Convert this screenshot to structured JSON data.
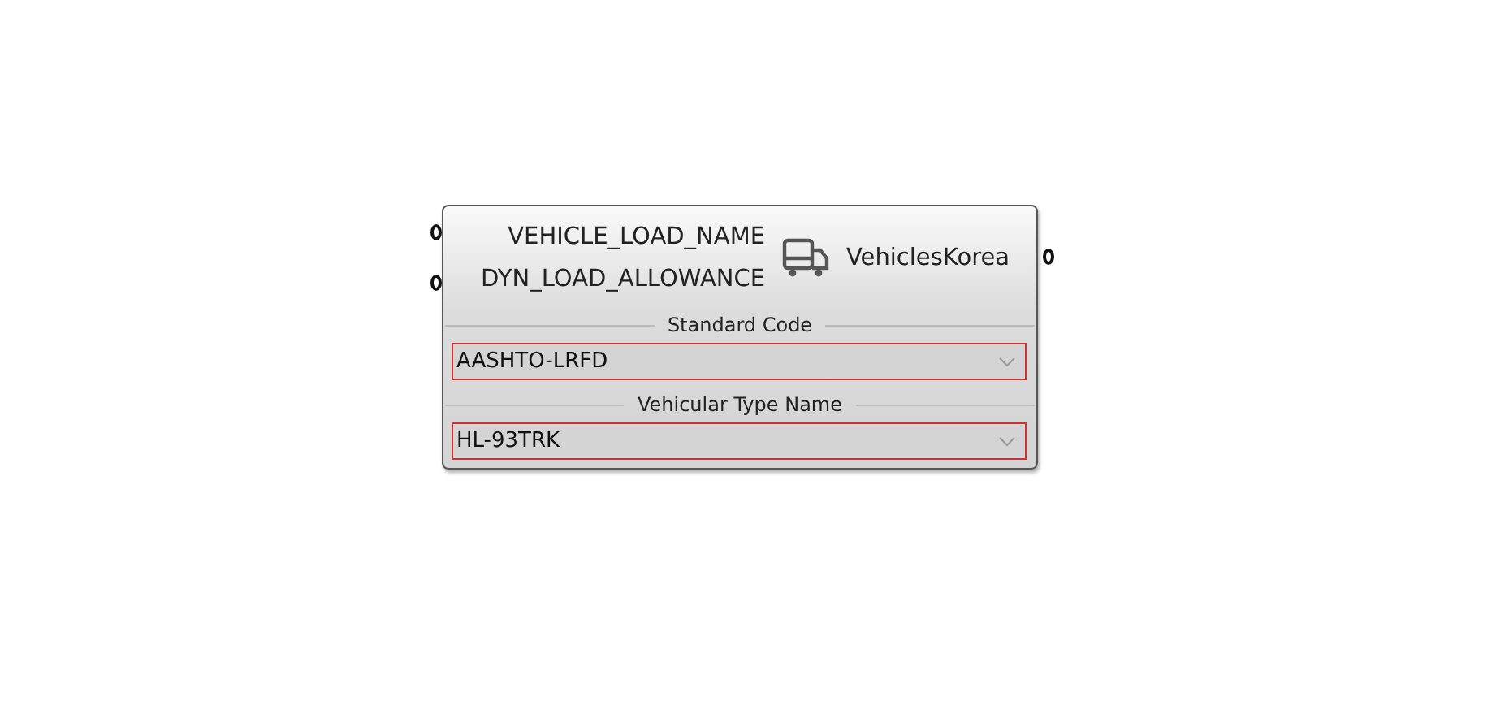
{
  "component": {
    "name": "VehiclesKorea",
    "inputs": [
      {
        "label": "VEHICLE_LOAD_NAME"
      },
      {
        "label": "DYN_LOAD_ALLOWANCE"
      }
    ],
    "fields": [
      {
        "title": "Standard Code",
        "value": "AASHTO-LRFD"
      },
      {
        "title": "Vehicular Type Name",
        "value": "HL-93TRK"
      }
    ]
  }
}
